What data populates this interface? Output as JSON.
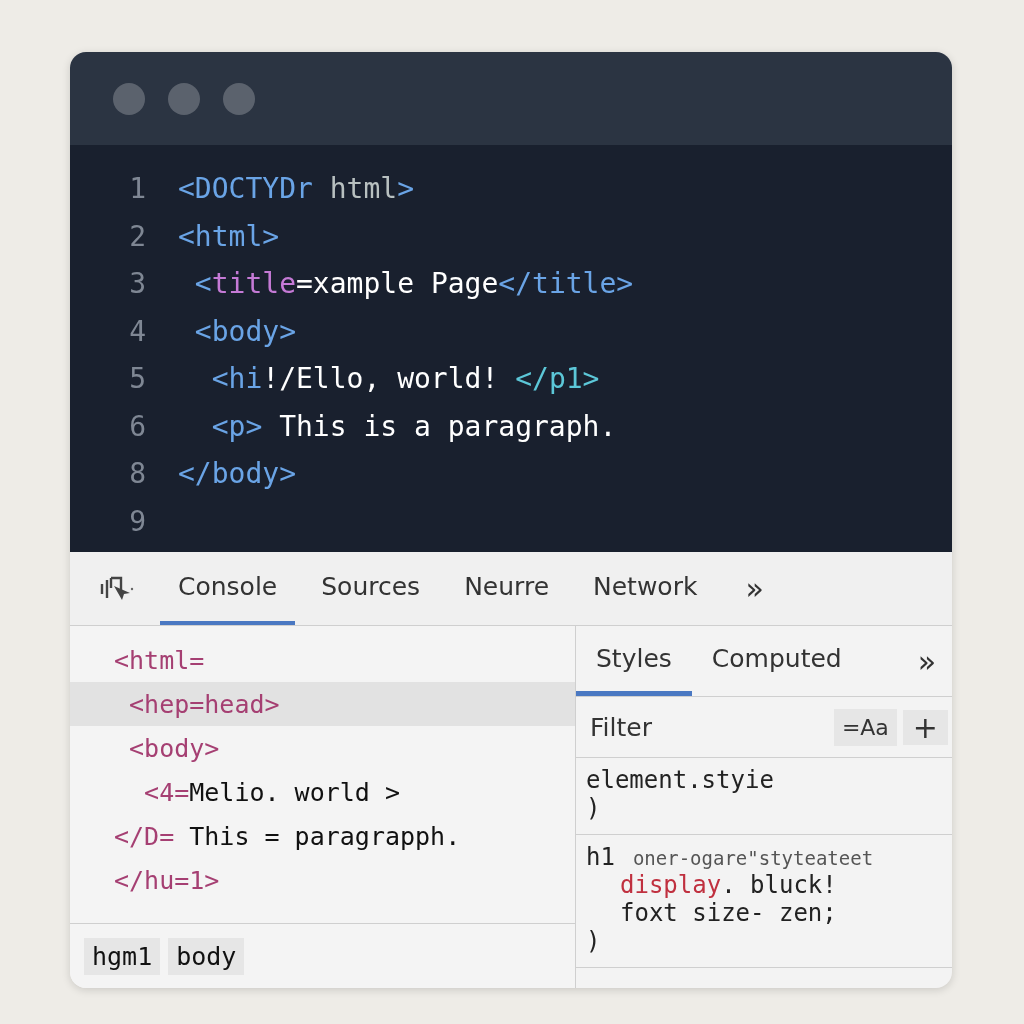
{
  "editor": {
    "lines": [
      {
        "number": "1",
        "segments": [
          {
            "kind": "tag",
            "text": "<DOCTYDr"
          },
          {
            "kind": "plain",
            "text": " html"
          },
          {
            "kind": "tag",
            "text": ">"
          }
        ]
      },
      {
        "number": "2",
        "segments": [
          {
            "kind": "tag",
            "text": "<html>"
          }
        ]
      },
      {
        "number": "3",
        "segments": [
          {
            "kind": "tag",
            "text": " <"
          },
          {
            "kind": "keyword",
            "text": "title"
          },
          {
            "kind": "text",
            "text": "=xample Page"
          },
          {
            "kind": "tag",
            "text": "</title>"
          }
        ]
      },
      {
        "number": "4",
        "segments": [
          {
            "kind": "tag",
            "text": " <body>"
          }
        ]
      },
      {
        "number": "5",
        "segments": [
          {
            "kind": "tag",
            "text": "  <hi"
          },
          {
            "kind": "text",
            "text": "!/Ello, world! "
          },
          {
            "kind": "closing",
            "text": "</p1>"
          }
        ]
      },
      {
        "number": "6",
        "segments": [
          {
            "kind": "tag",
            "text": "  <p>"
          },
          {
            "kind": "text",
            "text": " This is a paragraph."
          }
        ]
      },
      {
        "number": "8",
        "segments": [
          {
            "kind": "tag",
            "text": "</body>"
          }
        ]
      },
      {
        "number": "9"
      }
    ]
  },
  "devtools": {
    "tabs": [
      {
        "label": "Console",
        "selected": true
      },
      {
        "label": "Sources",
        "selected": false
      },
      {
        "label": "Neurre",
        "selected": false
      },
      {
        "label": "Network",
        "selected": false
      }
    ],
    "more": "»",
    "elements": {
      "rows": [
        {
          "selected": false,
          "segments": [
            {
              "kind": "tag",
              "text": "<html="
            }
          ]
        },
        {
          "selected": true,
          "segments": [
            {
              "kind": "tag",
              "text": " <hep=head>"
            }
          ]
        },
        {
          "selected": false,
          "segments": [
            {
              "kind": "tag",
              "text": " <body>"
            }
          ]
        },
        {
          "selected": false,
          "segments": [
            {
              "kind": "tag",
              "text": "  <4="
            },
            {
              "kind": "text",
              "text": "Melio. world >"
            }
          ]
        },
        {
          "selected": false,
          "segments": [
            {
              "kind": "tag",
              "text": "</D= "
            },
            {
              "kind": "text",
              "text": "This = paragrapph."
            }
          ]
        },
        {
          "selected": false,
          "segments": [
            {
              "kind": "tag",
              "text": "</hu=1>"
            }
          ]
        }
      ],
      "breadcrumbs": [
        "hgm1",
        "body"
      ]
    },
    "styles": {
      "tabs": [
        {
          "label": "Styles",
          "selected": true
        },
        {
          "label": "Computed",
          "selected": false
        }
      ],
      "more": "»",
      "filter": {
        "placeholder": "Filter"
      },
      "class_button": "=Aa",
      "add_button": "+",
      "rules": [
        {
          "selector": "element.styie",
          "close": ")"
        },
        {
          "selector": "h1",
          "source": "oner-ogare\"styteateet",
          "declarations": [
            {
              "property": "display",
              "value": ". bluck!"
            },
            {
              "value": "foxt size- zen;"
            }
          ],
          "close": ")"
        }
      ]
    }
  }
}
